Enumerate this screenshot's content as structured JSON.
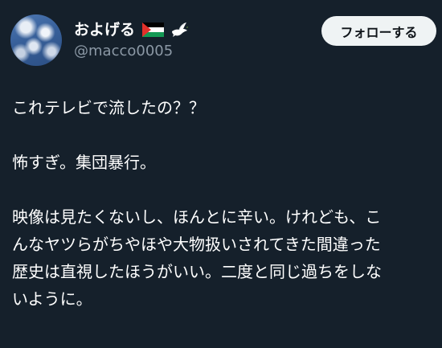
{
  "profile": {
    "display_name": "およげる",
    "handle": "@macco0005",
    "follow_label": "フォローする"
  },
  "icons": {
    "avatar": "sky-clouds-avatar",
    "flag": "palestine-flag-icon",
    "dove": "dove-icon"
  },
  "tweet": {
    "line1": "これテレビで流したの？？",
    "line2": "怖すぎ。集団暴行。",
    "line3": "映像は見たくないし、ほんとに辛い。けれども、こ",
    "line4": "んなヤツらがちやほや大物扱いされてきた間違った",
    "line5": "歴史は直視したほうがいい。二度と同じ過ちをしな",
    "line6": "いように。"
  },
  "colors": {
    "background": "#15202b",
    "handle": "#8b98a5",
    "button_bg": "#eff3f4",
    "button_text": "#0f1419"
  }
}
